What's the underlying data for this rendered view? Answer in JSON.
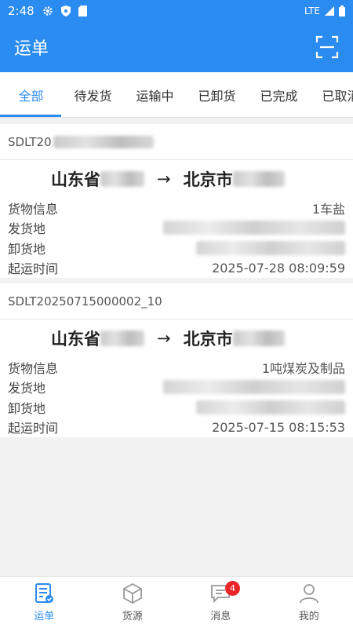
{
  "status_bar": {
    "time": "2:48",
    "network": "LTE"
  },
  "app_bar": {
    "title": "运单"
  },
  "tabs": [
    {
      "label": "全部",
      "active": true
    },
    {
      "label": "待发货"
    },
    {
      "label": "运输中"
    },
    {
      "label": "已卸货"
    },
    {
      "label": "已完成"
    },
    {
      "label": "已取消"
    }
  ],
  "orders": [
    {
      "id": "SDLT20",
      "from": "山东省",
      "to": "北京市",
      "arrow": "→",
      "cargo_label": "货物信息",
      "cargo_value": "1车盐",
      "ship_label": "发货地",
      "unload_label": "卸货地",
      "time_label": "起运时间",
      "time_value": "2025-07-28 08:09:59"
    },
    {
      "id": "SDLT20250715000002_10",
      "from": "山东省",
      "to": "北京市",
      "arrow": "→",
      "cargo_label": "货物信息",
      "cargo_value": "1吨煤炭及制品",
      "ship_label": "发货地",
      "unload_label": "卸货地",
      "time_label": "起运时间",
      "time_value": "2025-07-15 08:15:53"
    }
  ],
  "bottom_nav": [
    {
      "label": "运单",
      "icon": "waybill-icon",
      "active": true
    },
    {
      "label": "货源",
      "icon": "cargo-box-icon"
    },
    {
      "label": "消息",
      "icon": "message-icon",
      "badge": "4"
    },
    {
      "label": "我的",
      "icon": "profile-icon"
    }
  ],
  "colors": {
    "primary": "#2a8cf0",
    "badge": "#e8262a"
  }
}
